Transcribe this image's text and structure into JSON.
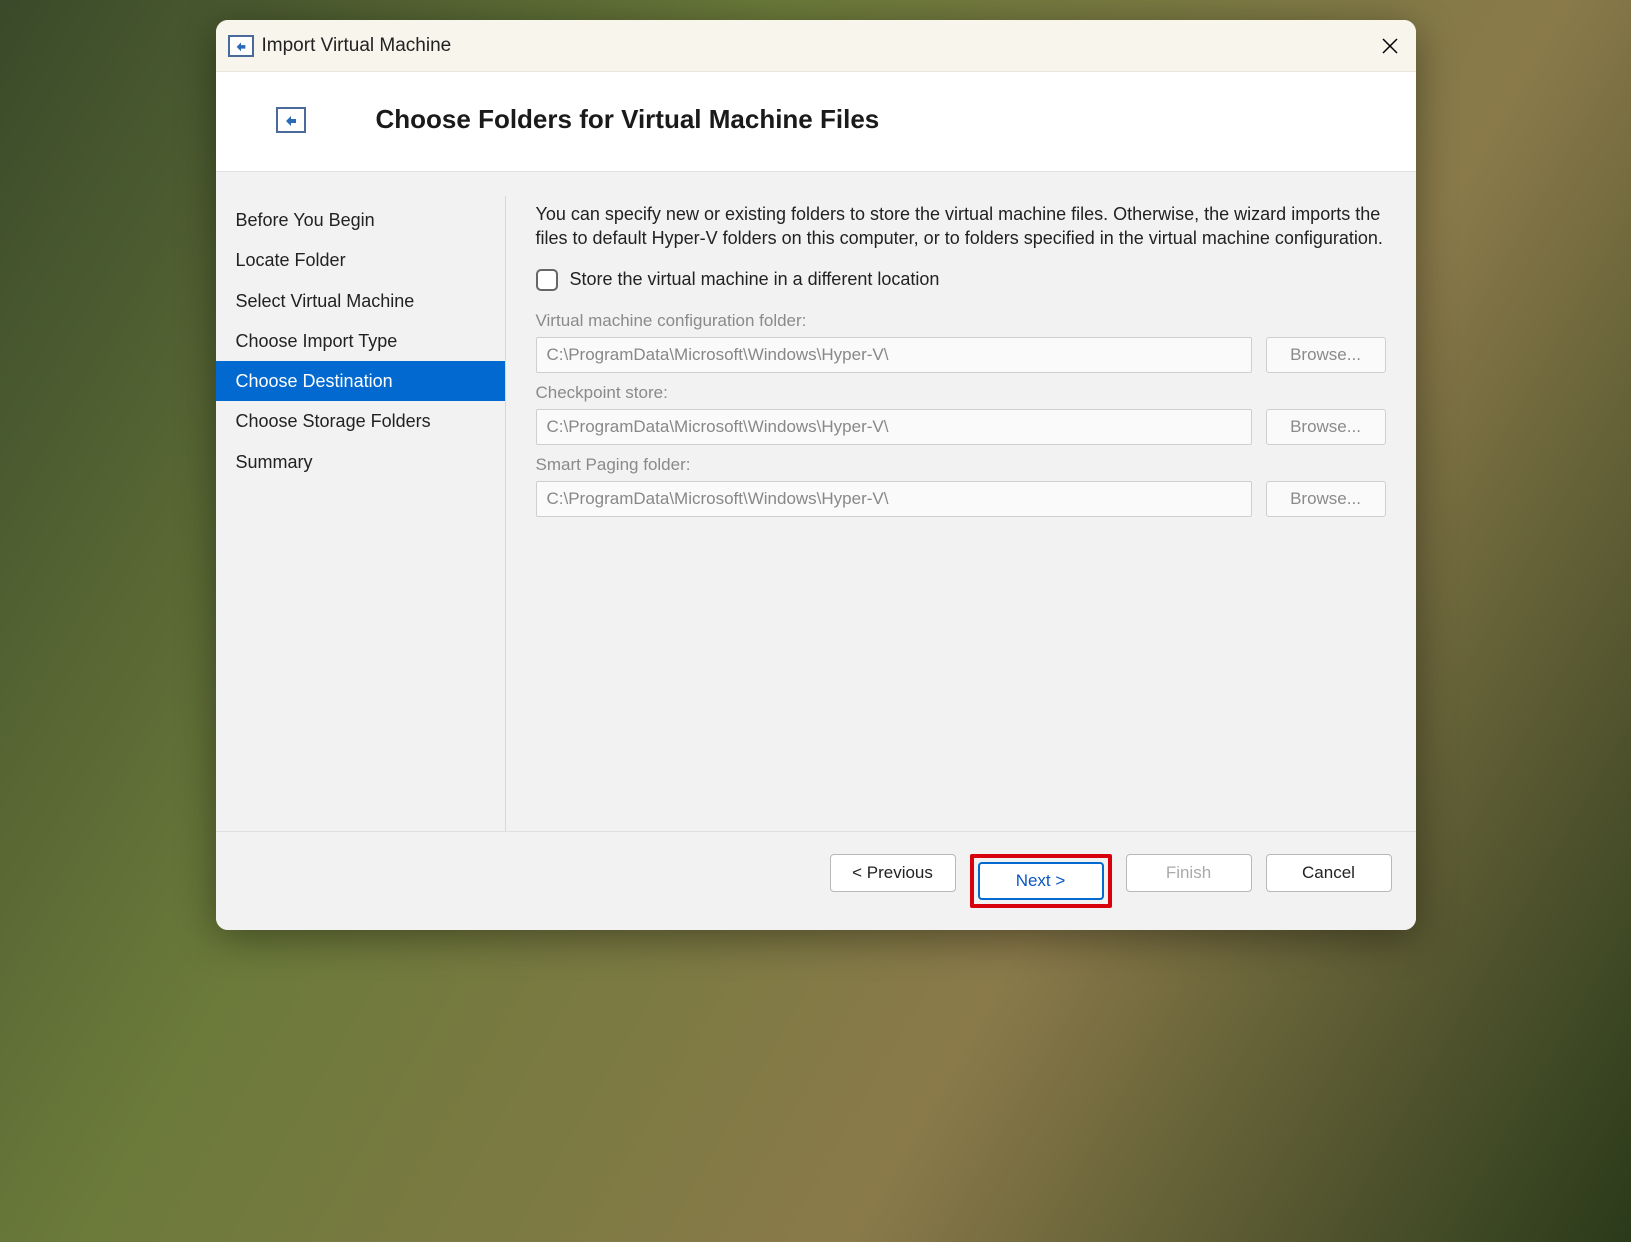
{
  "titlebar": {
    "title": "Import Virtual Machine"
  },
  "header": {
    "title": "Choose Folders for Virtual Machine Files"
  },
  "sidebar": {
    "items": [
      {
        "label": "Before You Begin",
        "selected": false
      },
      {
        "label": "Locate Folder",
        "selected": false
      },
      {
        "label": "Select Virtual Machine",
        "selected": false
      },
      {
        "label": "Choose Import Type",
        "selected": false
      },
      {
        "label": "Choose Destination",
        "selected": true
      },
      {
        "label": "Choose Storage Folders",
        "selected": false
      },
      {
        "label": "Summary",
        "selected": false
      }
    ]
  },
  "pane": {
    "intro": "You can specify new or existing folders to store the virtual machine files. Otherwise, the wizard imports the files to default Hyper-V folders on this computer, or to folders specified in the virtual machine configuration.",
    "checkbox_label": "Store the virtual machine in a different location",
    "checkbox_checked": false,
    "fields": [
      {
        "label": "Virtual machine configuration folder:",
        "value": "C:\\ProgramData\\Microsoft\\Windows\\Hyper-V\\",
        "browse": "Browse..."
      },
      {
        "label": "Checkpoint store:",
        "value": "C:\\ProgramData\\Microsoft\\Windows\\Hyper-V\\",
        "browse": "Browse..."
      },
      {
        "label": "Smart Paging folder:",
        "value": "C:\\ProgramData\\Microsoft\\Windows\\Hyper-V\\",
        "browse": "Browse..."
      }
    ]
  },
  "footer": {
    "previous": "< Previous",
    "next": "Next >",
    "finish": "Finish",
    "cancel": "Cancel"
  }
}
